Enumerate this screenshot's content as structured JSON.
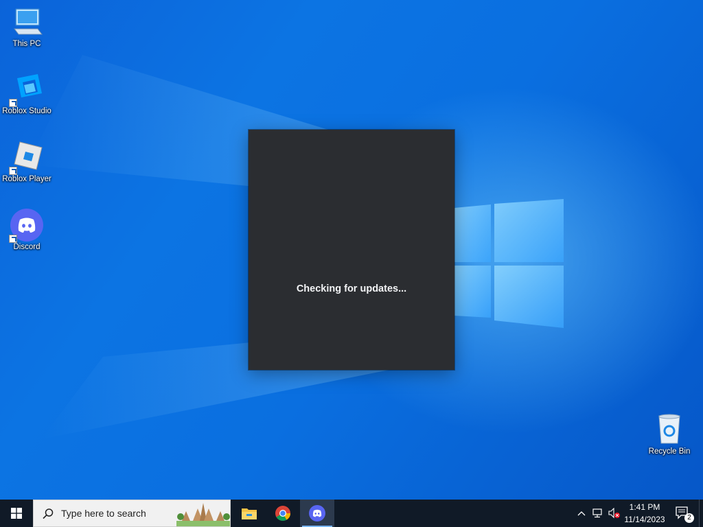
{
  "desktop": {
    "icons": [
      {
        "label": "This PC",
        "icon": "this-pc-icon"
      },
      {
        "label": "Roblox Studio",
        "icon": "roblox-studio-icon"
      },
      {
        "label": "Roblox Player",
        "icon": "roblox-player-icon"
      },
      {
        "label": "Discord",
        "icon": "discord-icon"
      },
      {
        "label": "Recycle Bin",
        "icon": "recycle-bin-icon"
      }
    ]
  },
  "updater": {
    "status_text": "Checking for updates..."
  },
  "taskbar": {
    "search_placeholder": "Type here to search",
    "pinned": [
      "file-explorer-icon",
      "chrome-icon",
      "discord-icon"
    ],
    "active": "discord-icon",
    "clock": {
      "time": "1:41 PM",
      "date": "11/14/2023"
    },
    "notification_count": "2"
  },
  "colors": {
    "desktop_blue": "#0a6fe0",
    "updater_bg": "#2b2d31",
    "taskbar_bg": "#101a27",
    "discord_blurple": "#5865f2"
  }
}
